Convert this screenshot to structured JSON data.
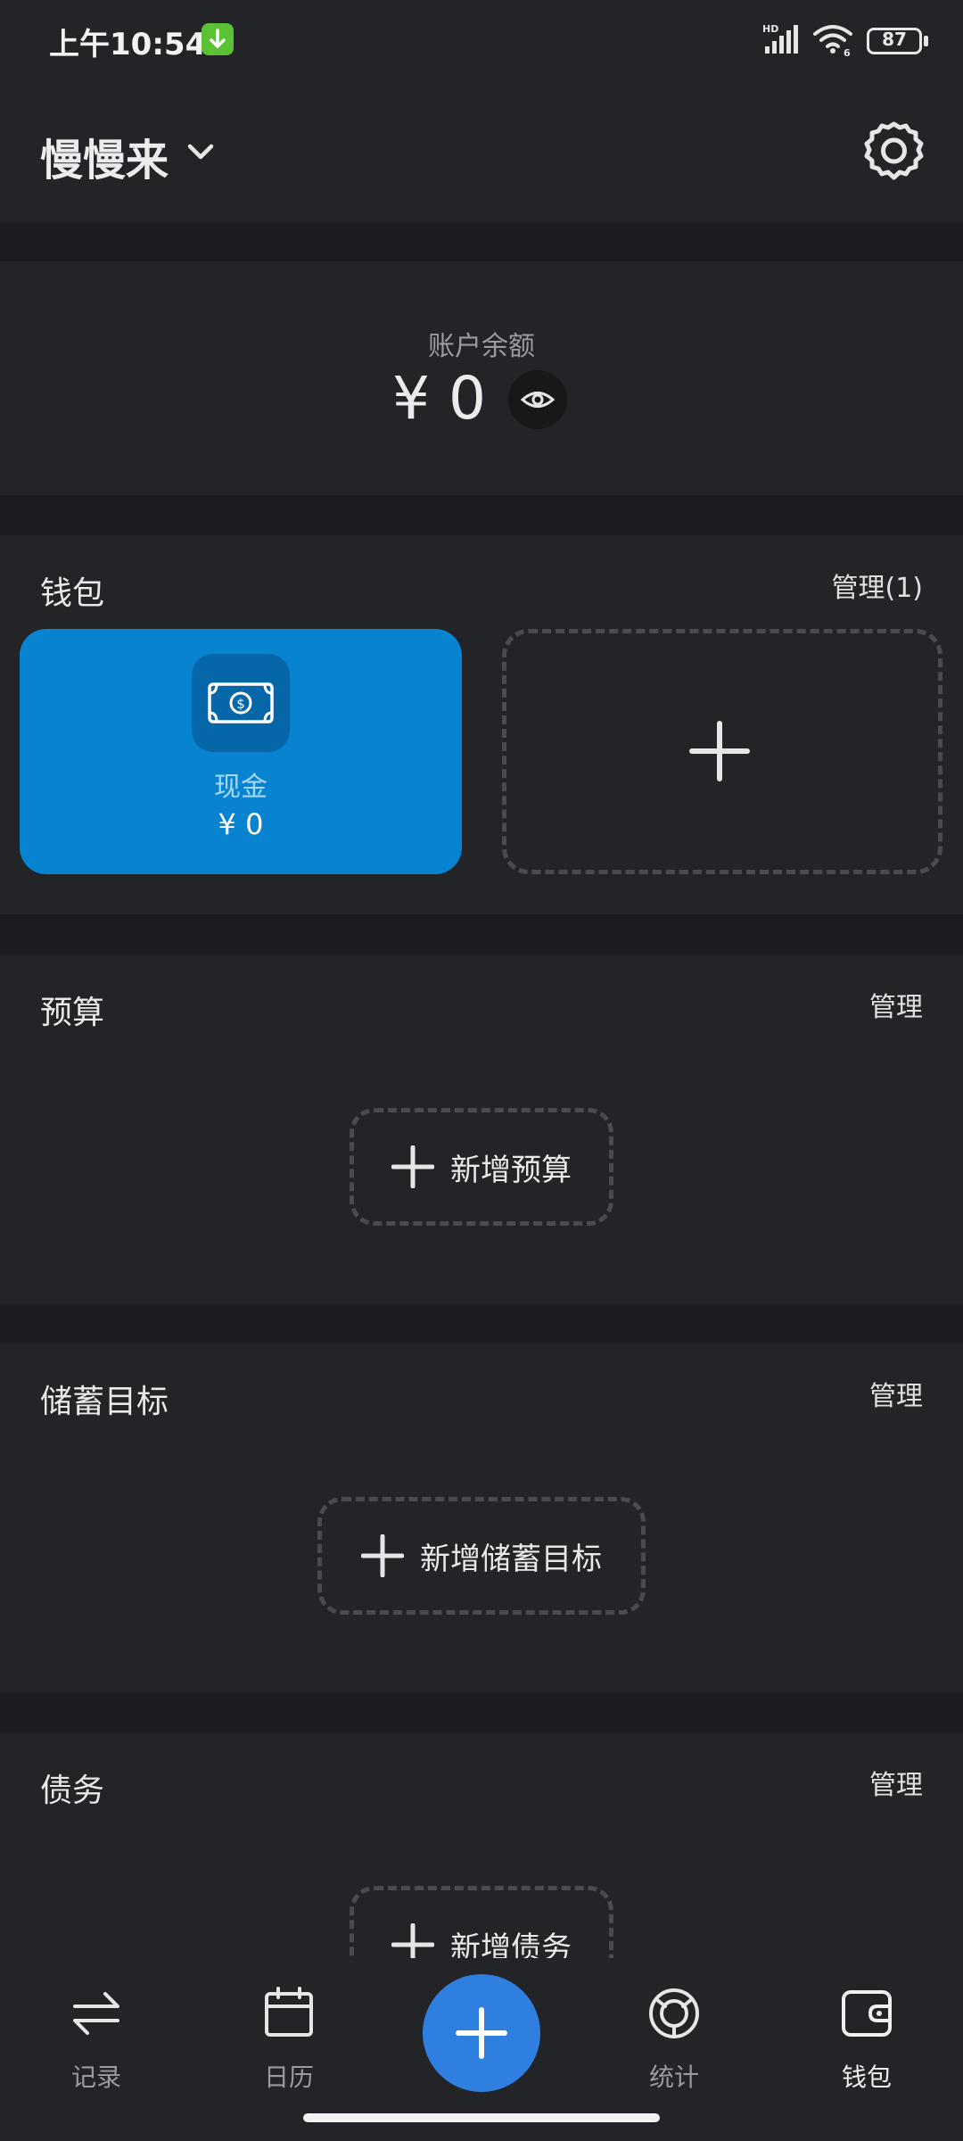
{
  "status_bar": {
    "time": "上午10:54",
    "battery": "87",
    "network": "HD",
    "wifi_label": "6",
    "icons": [
      "download-notification-icon",
      "signal-icon",
      "wifi-icon",
      "battery-icon"
    ]
  },
  "header": {
    "title": "慢慢来",
    "icons": [
      "chevron-down-icon",
      "gear-icon"
    ]
  },
  "balance": {
    "label": "账户余额",
    "value": "¥ 0",
    "icons": [
      "eye-icon"
    ]
  },
  "wallet": {
    "title": "钱包",
    "manage": "管理(1)",
    "items": [
      {
        "name": "现金",
        "amount": "¥ 0",
        "icon": "banknote-icon",
        "color": "#0783d0"
      }
    ],
    "add_icon": "plus-icon"
  },
  "budget": {
    "title": "预算",
    "manage": "管理",
    "add_label": "新增预算"
  },
  "savings": {
    "title": "储蓄目标",
    "manage": "管理",
    "add_label": "新增储蓄目标"
  },
  "debt": {
    "title": "债务",
    "manage": "管理",
    "add_label": "新增债务"
  },
  "bottom_nav": {
    "items": [
      {
        "label": "记录",
        "icon": "transfer-arrows-icon",
        "active": false
      },
      {
        "label": "日历",
        "icon": "calendar-icon",
        "active": false
      },
      {
        "label": "统计",
        "icon": "chart-ring-icon",
        "active": false
      },
      {
        "label": "钱包",
        "icon": "wallet-icon",
        "active": true
      }
    ],
    "fab_icon": "plus-icon"
  },
  "colors": {
    "background": "#1b1c1f",
    "card": "#232428",
    "accent": "#2e7fe0",
    "wallet_tile": "#0783d0",
    "badge": "#5bc236"
  }
}
